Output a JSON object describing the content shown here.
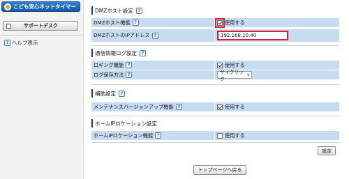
{
  "sidebar": {
    "logo_text": "こども安心ネットタイマー",
    "support_label": "サポートデスク",
    "help_badge": "?",
    "help_label": "ヘルプ表示"
  },
  "help_badge": "?",
  "dmz": {
    "title": "DMZホスト設定",
    "rows": [
      {
        "label": "DMZホスト機能",
        "checkbox_label": "使用する",
        "checked": true
      },
      {
        "label": "DMZホストのIPアドレス",
        "value": "192.168.10.40"
      }
    ]
  },
  "log": {
    "title": "通信情報ログ設定",
    "rows": [
      {
        "label": "ロギング機能",
        "checkbox_label": "使用する",
        "checked": true
      },
      {
        "label": "ログ保存方法",
        "select_value": "サイクリック",
        "select_arrow": "∨"
      }
    ]
  },
  "aux": {
    "title": "補助設定",
    "rows": [
      {
        "label": "メンテナンスバージョンアップ機能",
        "checkbox_label": "使用する",
        "checked": true
      }
    ]
  },
  "homeip": {
    "title": "ホームIPロケーション設定",
    "rows": [
      {
        "label": "ホームIPロケーション機能",
        "checkbox_label": "使用する",
        "checked": false
      }
    ]
  },
  "buttons": {
    "apply": "設定",
    "top_page": "トップページへ戻る"
  },
  "colors": {
    "row_bg": "#c8dcf1",
    "highlight": "#d8202a",
    "logo_bg": "#1659a8"
  }
}
